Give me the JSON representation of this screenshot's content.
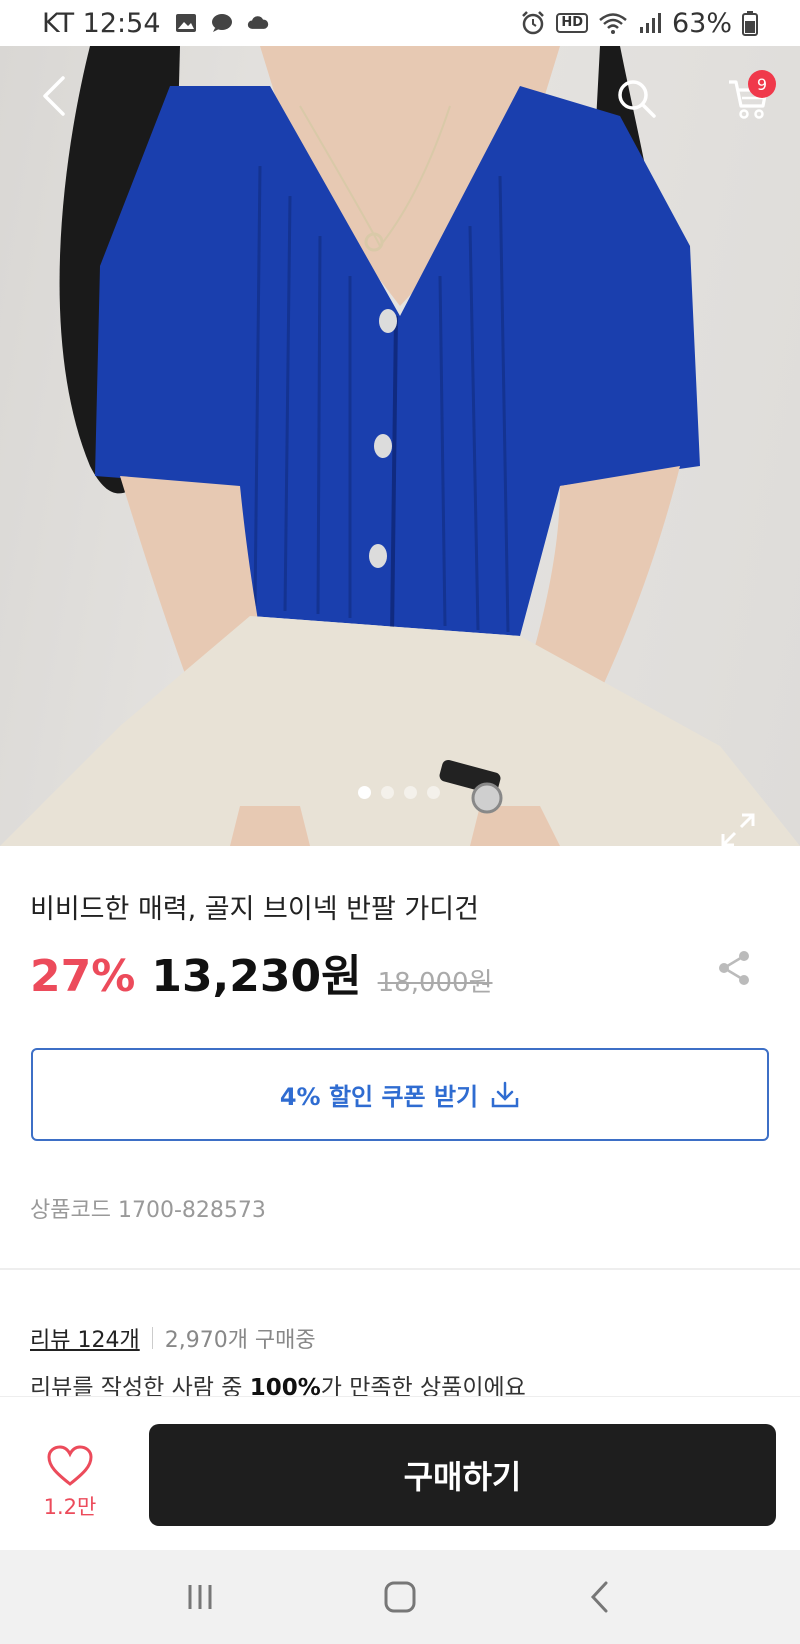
{
  "status_bar": {
    "carrier_time": "KT 12:54",
    "battery": "63%",
    "hd_label": "HD"
  },
  "hero": {
    "cart_count": "9",
    "carousel_total": 4,
    "carousel_active": 1,
    "colors": {
      "cardigan": "#1a3fae",
      "pants": "#e8e2d6",
      "hair": "#1a1a1a",
      "skin": "#e7c9b3"
    }
  },
  "product": {
    "title": "비비드한 매력, 골지 브이넥 반팔 가디건",
    "discount": "27%",
    "price": "13,230원",
    "original_price": "18,000원",
    "coupon_label": "4% 할인 쿠폰 받기",
    "code_label": "상품코드 1700-828573"
  },
  "reviews": {
    "review_link": "리뷰 124개",
    "buying_count": "2,970개 구매중",
    "satisfaction_prefix": "리뷰를 작성한 사람 중 ",
    "satisfaction_percent": "100%",
    "satisfaction_suffix": "가 만족한 상품이에요"
  },
  "action_bar": {
    "like_count": "1.2만",
    "buy_label": "구매하기"
  },
  "icons": [
    "back-icon",
    "search-icon",
    "cart-icon",
    "expand-icon",
    "share-icon",
    "download-icon",
    "heart-icon",
    "recent-apps-icon",
    "home-icon",
    "nav-back-icon"
  ],
  "theme": {
    "accent_red": "#ec4b5b",
    "coupon_blue": "#2f6cd1",
    "buy_button": "#1e1e1e"
  }
}
